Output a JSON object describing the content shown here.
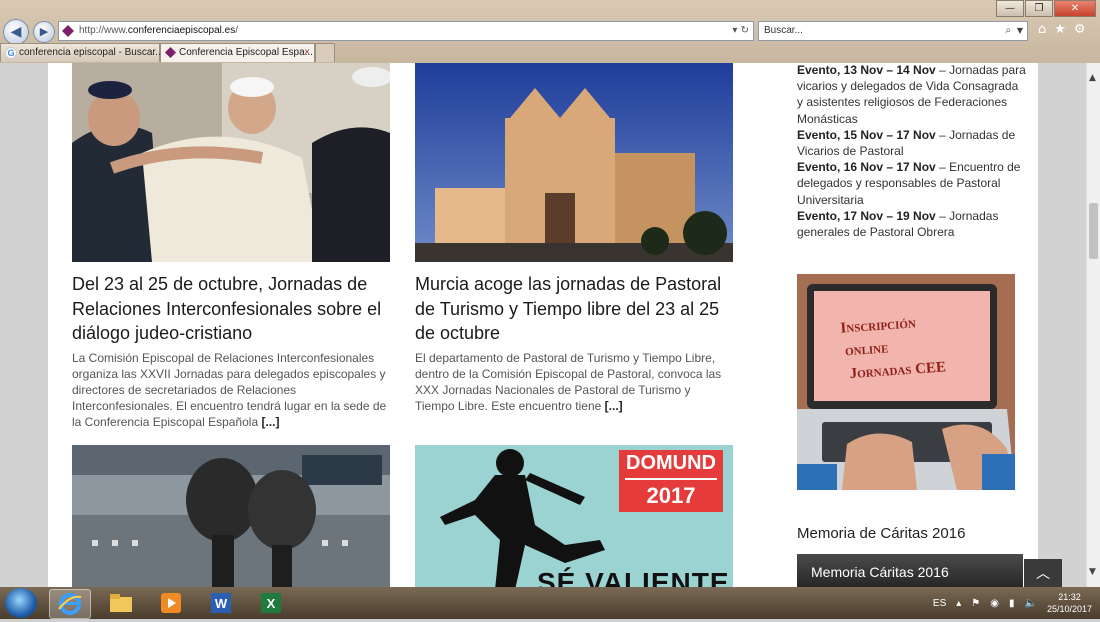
{
  "browser": {
    "address": {
      "prefix": "http://www.",
      "domain": "conferenciaepiscopal.es",
      "suffix": "/"
    },
    "address_controls": "▾ ↻",
    "search_placeholder": "Buscar...",
    "search_icon": "⌕",
    "tabs": [
      {
        "label": "conferencia episcopal - Buscar...",
        "icon": "google-icon"
      },
      {
        "label": "Conferencia Episcopal Espa...",
        "icon": "cee-icon",
        "close": "×"
      }
    ],
    "window_buttons": {
      "minimize": "—",
      "restore": "❐",
      "close": "✕"
    },
    "toolbar_icons": {
      "home": "⌂",
      "favorites": "★",
      "tools": "⚙"
    }
  },
  "articles": [
    {
      "title": "Del 23 al 25 de octubre, Jornadas de Relaciones Interconfesionales sobre el diálogo judeo-cristiano",
      "excerpt": "La Comisión Episcopal de Relaciones Interconfesionales organiza las XXVII Jornadas para delegados episcopales y directores de secretariados de Relaciones Interconfesionales. El encuentro tendrá lugar en la sede de la Conferencia Episcopal Española",
      "more": "[...]"
    },
    {
      "title": "Murcia acoge las jornadas de Pastoral de Turismo y Tiempo libre del 23 al 25 de octubre",
      "excerpt": "El departamento de Pastoral de Turismo y Tiempo Libre, dentro de la Comisión Episcopal de Pastoral, convoca las XXX Jornadas Nacionales de Pastoral de Turismo y Tiempo Libre. Este encuentro tiene",
      "more": "[...]"
    }
  ],
  "domund": {
    "line1": "DOMUND",
    "line2": "2017",
    "slogan": "SÉ VALIENTE"
  },
  "sidebar": {
    "events": [
      {
        "label": "Evento, 13 Nov – 14 Nov",
        "text": " – Jornadas para vicarios y delegados de Vida Consagrada y asistentes religiosos de Federaciones Monásticas"
      },
      {
        "label": "Evento, 15 Nov – 17 Nov",
        "text": " – Jornadas de Vicarios de Pastoral"
      },
      {
        "label": "Evento, 16 Nov – 17 Nov",
        "text": " – Encuentro de delegados y responsables de Pastoral Universitaria"
      },
      {
        "label": "Evento, 17 Nov – 19 Nov",
        "text": " – Jornadas generales de Pastoral Obrera"
      }
    ],
    "banner": {
      "line1": "Inscripción",
      "line2": "online",
      "line3": "Jornadas CEE"
    },
    "caritas_heading": "Memoria de Cáritas 2016",
    "caritas_banner": "Memoria Cáritas 2016",
    "to_top": "︿"
  },
  "taskbar": {
    "lang": "ES",
    "time": "21:32",
    "date": "25/10/2017",
    "apps": [
      "internet-explorer",
      "file-explorer",
      "media-player",
      "word",
      "excel"
    ]
  },
  "colors": {
    "domund_red": "#e53b3b",
    "caritas_bg": "#2a2a2a",
    "cee_purple": "#7a1f6b"
  }
}
